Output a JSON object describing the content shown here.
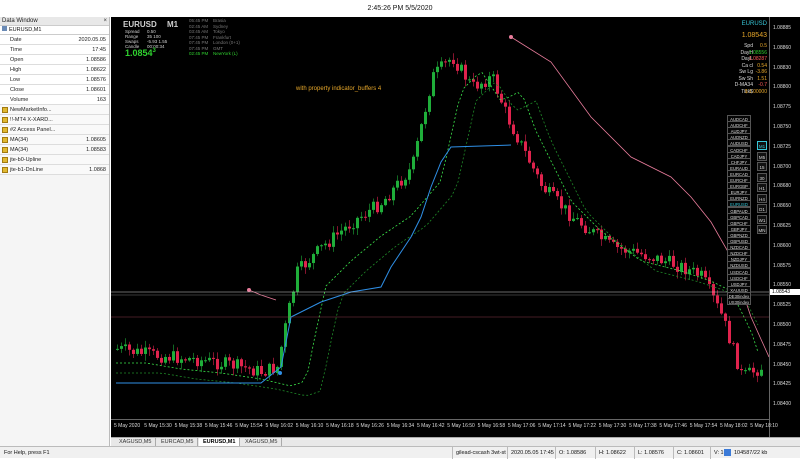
{
  "window": {
    "clock": "2:45:26 PM 5/5/2020"
  },
  "data_window": {
    "title": "Data Window",
    "close_glyph": "×",
    "symbol": "EURUSD,M1",
    "rows": [
      {
        "name": "Date",
        "value": "2020.05.05",
        "icon": false
      },
      {
        "name": "Time",
        "value": "17:45",
        "icon": false
      },
      {
        "name": "Open",
        "value": "1.08586",
        "icon": false
      },
      {
        "name": "High",
        "value": "1.08622",
        "icon": false
      },
      {
        "name": "Low",
        "value": "1.08576",
        "icon": false
      },
      {
        "name": "Close",
        "value": "1.08601",
        "icon": false
      },
      {
        "name": "Volume",
        "value": "163",
        "icon": false
      },
      {
        "name": "NewMarketInfo...",
        "value": "",
        "icon": true
      },
      {
        "name": "!!-MT4 X-XARD...",
        "value": "",
        "icon": true
      },
      {
        "name": "#2 Access Panel...",
        "value": "",
        "icon": true
      },
      {
        "name": "MA(34)",
        "value": "1.08605",
        "icon": true
      },
      {
        "name": "MA(34)",
        "value": "1.08583",
        "icon": true
      },
      {
        "name": "jte-b0-Upline",
        "value": "",
        "icon": true
      },
      {
        "name": "jte-b1-DnLine",
        "value": "1.0868",
        "icon": true
      }
    ]
  },
  "chart": {
    "info_panel": {
      "symbol": "EURUSD",
      "timeframe": "M1",
      "lines": [
        {
          "label": "Spread",
          "value": "0.50"
        },
        {
          "label": "Range",
          "value": "35 100"
        },
        {
          "label": "Swaps",
          "value": "-5.93  1.55"
        },
        {
          "label": "Candle",
          "value": "00:00:34"
        }
      ],
      "price": "1.0854",
      "price_digit": "3",
      "sessions": [
        {
          "time": "05:45 PM",
          "city": "Brasia",
          "active": false
        },
        {
          "time": "02:45 AM",
          "city": "Sydney",
          "active": false
        },
        {
          "time": "03:45 AM",
          "city": "Tokyo",
          "active": false
        },
        {
          "time": "07:45 PM",
          "city": "Frankfurt",
          "active": false
        },
        {
          "time": "07:45 PM",
          "city": "London (0+1)",
          "active": false
        },
        {
          "time": "07:45 PM",
          "city": "GMT",
          "active": false
        },
        {
          "time": "02:45 PM",
          "city": "NewYork (L)",
          "active": true
        }
      ]
    },
    "buffer_note": "with property indicator_buffers 4",
    "right_panel": {
      "symbol": "EURUSD",
      "price": "1.08543",
      "rows": [
        {
          "label": "Spd",
          "value": "0.5",
          "color": "#e8a82a"
        },
        {
          "label": "DayH",
          "value": "1.08556",
          "color": "#2fd12f"
        },
        {
          "label": "DayL",
          "value": "1.08287",
          "color": "#ff5a5a"
        },
        {
          "label": "Ca cl",
          "value": "0.54",
          "color": "#e8a82a"
        },
        {
          "label": "Sw Lg",
          "value": "-3.86",
          "color": "#e8a82a"
        },
        {
          "label": "Sw Sh",
          "value": "1.51",
          "color": "#e8a82a"
        },
        {
          "label": "D-MA34",
          "value": "-0.7",
          "color": "#ff5a5a"
        },
        {
          "label": "Tick$",
          "value": "$ 1.00000",
          "color": "#e8a82a"
        }
      ]
    },
    "pairs": [
      "AUDCAD",
      "AUDCHF",
      "AUDJPY",
      "AUDNZD",
      "AUDUSD",
      "CADCHF",
      "CADJPY",
      "CHFJPY",
      "EURAUD",
      "EURCAD",
      "EURCHF",
      "EURGBP",
      "EURJPY",
      "EURNZD",
      "EURUSD",
      "GBPAUD",
      "GBPCAD",
      "GBPCHF",
      "GBPJPY",
      "GBPNZD",
      "GBPUSD",
      "NZDCAD",
      "NZDCHF",
      "NZDJPY",
      "NZDUSD",
      "USDCAD",
      "USDCHF",
      "USDJPY",
      "XAUUSD",
      "DE30index",
      "US30index"
    ],
    "selected_pair": "EURUSD",
    "timeframes": [
      "M1",
      "M5",
      "15",
      "30",
      "H1",
      "H4",
      "D1",
      "W1",
      "MN"
    ],
    "selected_timeframe": "M1",
    "y_ticks": [
      "1.08885",
      "1.08860",
      "1.08830",
      "1.08800",
      "1.08775",
      "1.08750",
      "1.08725",
      "1.08700",
      "1.08680",
      "1.08650",
      "1.08625",
      "1.08600",
      "1.08575",
      "1.08550",
      "1.08525",
      "1.08500",
      "1.08475",
      "1.08450",
      "1.08425",
      "1.08400"
    ],
    "y_highlight": "1.08543",
    "x_ticks": [
      "5 May 2020",
      "5 May 15:30",
      "5 May 15:38",
      "5 May 15:46",
      "5 May 15:54",
      "5 May 16:02",
      "5 May 16:10",
      "5 May 16:18",
      "5 May 16:26",
      "5 May 16:34",
      "5 May 16:42",
      "5 May 16:50",
      "5 May 16:58",
      "5 May 17:06",
      "5 May 17:14",
      "5 May 17:22",
      "5 May 17:30",
      "5 May 17:38",
      "5 May 17:46",
      "5 May 17:54",
      "5 May 18:02",
      "5 May 18:10"
    ],
    "colors": {
      "bull": "#1fae3a",
      "bear": "#e0234d",
      "ma_outer": "#1f8a28",
      "ma_inner": "#3be34a",
      "upline": "#2f8fe6",
      "pink": "#e87c9b",
      "white": "#cfcfcf"
    }
  },
  "tabs": [
    "XAGUSD,M5",
    "EURCAD,M5",
    "EURUSD,M1",
    "XAGUSD,M5"
  ],
  "active_tab": "EURUSD,M1",
  "status": {
    "help": "For Help, press F1",
    "profile": "gilead-cscash 3wt-st",
    "datetime": "2020.05.05 17:45",
    "open": "O: 1.08586",
    "high": "H: 1.08622",
    "low": "L: 1.08576",
    "close": "C: 1.08601",
    "volume": "V: 163",
    "traffic": "104587/22 kb"
  }
}
